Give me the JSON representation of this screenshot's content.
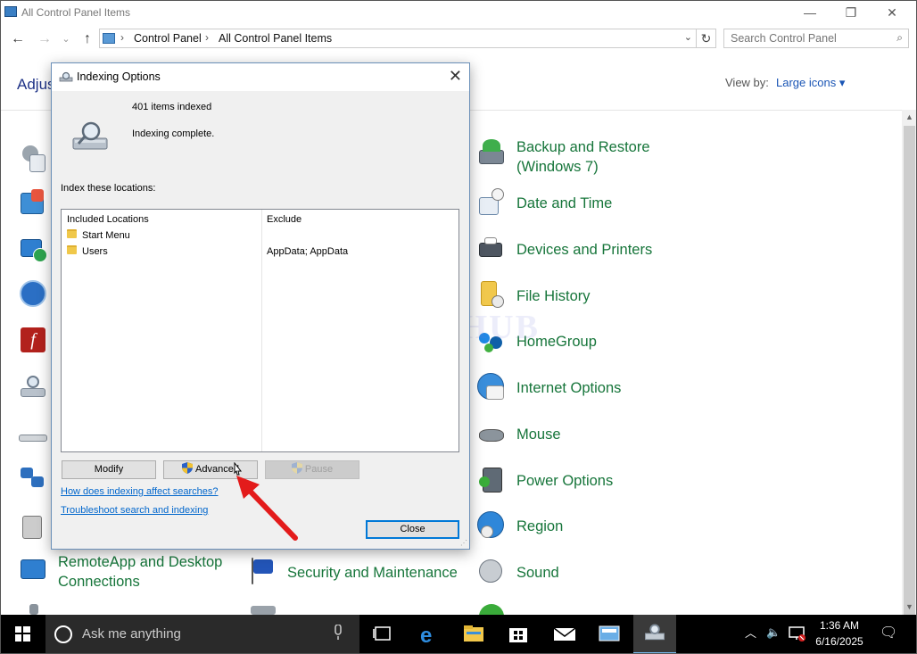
{
  "window": {
    "title": "All Control Panel Items",
    "minimize_glyph": "—",
    "restore_glyph": "❐",
    "close_glyph": "✕"
  },
  "nav": {
    "back_glyph": "←",
    "forward_glyph": "→",
    "dropdown_glyph": "⌄",
    "up_glyph": "↑",
    "breadcrumb": [
      "Control Panel",
      "All Control Panel Items"
    ],
    "breadcrumb_sep": "›",
    "address_dropdown_glyph": "⌄",
    "refresh_glyph": "↻"
  },
  "search": {
    "placeholder": "Search Control Panel",
    "icon": "search-icon"
  },
  "header": {
    "heading_partial": "Adjus",
    "view_by_label": "View by:",
    "view_by_value": "Large icons ▾"
  },
  "items_right": [
    {
      "label_line1": "Backup and Restore",
      "label_line2": "(Windows 7)",
      "icon": "backup-restore-icon"
    },
    {
      "label_line1": "Date and Time",
      "icon": "date-time-icon"
    },
    {
      "label_line1": "Devices and Printers",
      "icon": "devices-printers-icon"
    },
    {
      "label_line1": "File History",
      "icon": "file-history-icon"
    },
    {
      "label_line1": "HomeGroup",
      "icon": "homegroup-icon"
    },
    {
      "label_line1": "Internet Options",
      "icon": "internet-options-icon"
    },
    {
      "label_line1": "Mouse",
      "icon": "mouse-icon"
    },
    {
      "label_line1": "Power Options",
      "icon": "power-options-icon"
    },
    {
      "label_line1": "Region",
      "icon": "region-icon"
    },
    {
      "label_line1": "Sound",
      "icon": "sound-icon"
    }
  ],
  "items_bottom": [
    {
      "label_line1": "RemoteApp and Desktop",
      "label_line2": "Connections",
      "icon": "remoteapp-icon"
    },
    {
      "label_line1": "Security and Maintenance",
      "icon": "security-maintenance-icon"
    }
  ],
  "dialog": {
    "title": "Indexing Options",
    "close_glyph": "✕",
    "items_indexed": "401 items indexed",
    "status": "Indexing complete.",
    "index_label": "Index these locations:",
    "col_included": "Included Locations",
    "col_exclude": "Exclude",
    "locations": [
      {
        "name": "Start Menu",
        "exclude": ""
      },
      {
        "name": "Users",
        "exclude": "AppData; AppData"
      }
    ],
    "buttons": {
      "modify": "Modify",
      "advanced": "Advanced",
      "pause": "Pause",
      "close": "Close"
    },
    "links": {
      "how": "How does indexing affect searches?",
      "troubleshoot": "Troubleshoot search and indexing"
    },
    "grip_glyph": "⋰"
  },
  "watermark": "IT Pros HUB",
  "taskbar": {
    "search_placeholder": "Ask me anything",
    "time": "1:36 AM",
    "date": "6/16/2025",
    "tray_up_glyph": "︿",
    "speaker_glyph": "🔈",
    "notification_glyph": "🗨"
  },
  "colors": {
    "accent": "#0078d7",
    "item_text": "#16753a",
    "annotation_arrow": "#e31b1b"
  }
}
